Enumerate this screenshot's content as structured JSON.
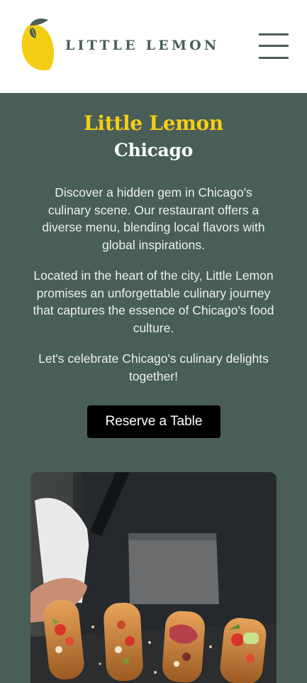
{
  "header": {
    "brand_name": "LITTLE LEMON",
    "logo_icon": "lemon-logo-icon",
    "menu_icon": "hamburger-menu-icon"
  },
  "hero": {
    "title": "Little Lemon",
    "subtitle": "Chicago",
    "paragraphs": [
      "Discover a hidden gem in Chicago's culinary scene. Our restaurant offers a diverse menu, blending local flavors with global inspirations.",
      "Located in the heart of the city, Little Lemon promises an unforgettable culinary journey that captures the essence of Chicago's food culture.",
      "Let's celebrate Chicago's culinary delights together!"
    ],
    "cta_label": "Reserve a Table"
  },
  "colors": {
    "primary_green": "#495e57",
    "primary_yellow": "#f4ce14",
    "button_black": "#000000",
    "text_light": "#edefee"
  }
}
